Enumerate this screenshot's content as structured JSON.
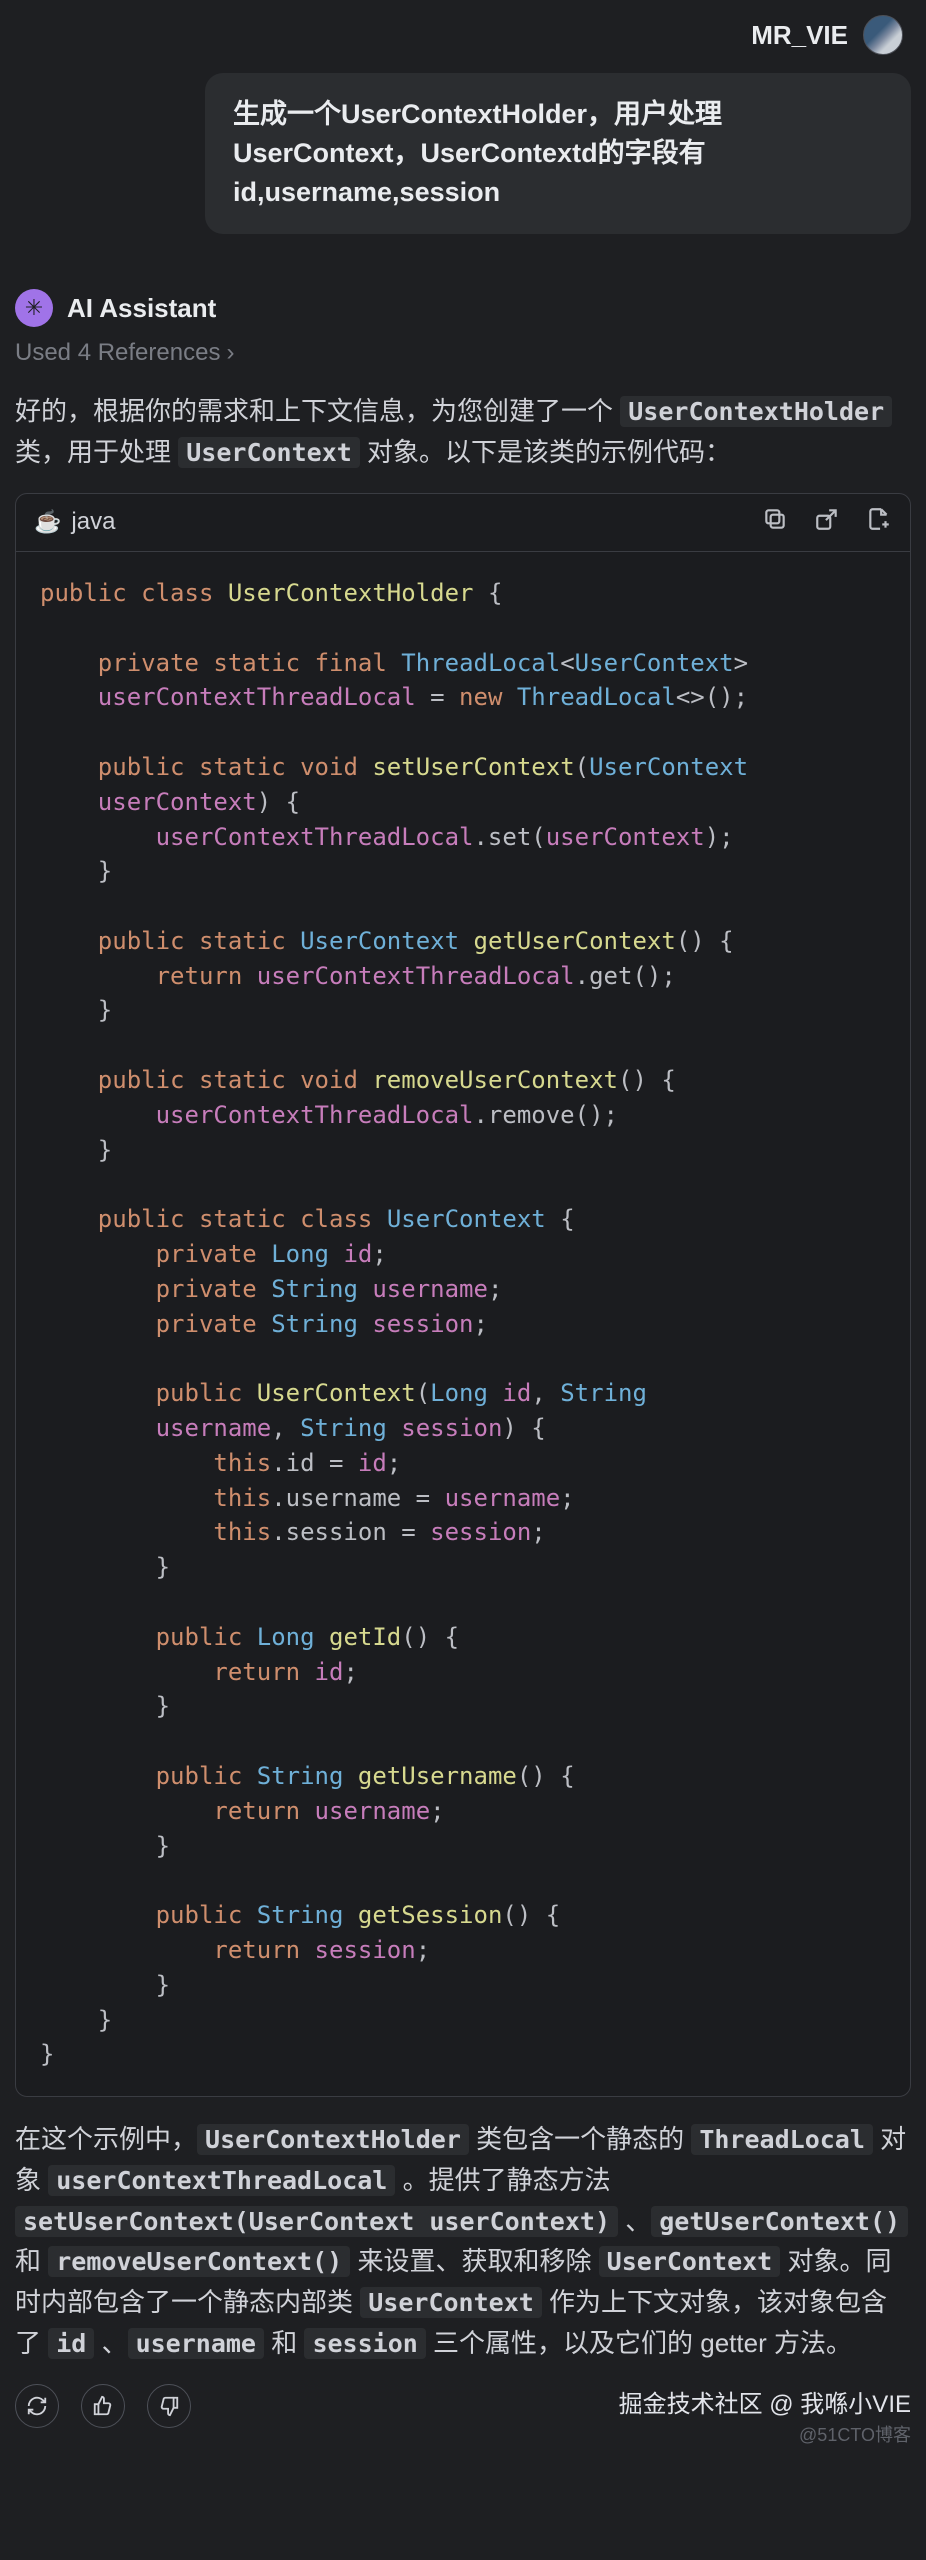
{
  "user": {
    "name": "MR_VIE"
  },
  "prompt": "生成一个UserContextHolder，用户处理UserContext，UserContextd的字段有id,username,session",
  "assistant_label": "AI Assistant",
  "references_label": "Used 4 References",
  "reply_intro_1": "好的，根据你的需求和上下文信息，为您创建了一个",
  "reply_intro_code1": "UserContextHolder",
  "reply_intro_2": " 类，用于处理 ",
  "reply_intro_code2": "UserContext",
  "reply_intro_3": " 对象。以下是该类的示例代码：",
  "code_lang": "java",
  "explain": {
    "l1a": "在这个示例中，",
    "c1": "UserContextHolder",
    "l1b": " 类包含一个静态的 ",
    "c2": "ThreadLocal",
    "l2a": " 对象 ",
    "c3": "userContextThreadLocal",
    "l2b": " 。提供了静态方法 ",
    "c4": "setUserContext(UserContext userContext)",
    "l3a": " 、",
    "c5": "getUserContext()",
    "l3b": " 和 ",
    "c6": "removeUserContext()",
    "l3c": " 来设置、获取和移除 ",
    "c7": "UserContext",
    "l4a": " 对象。同时内部包含了一个静态内部类 ",
    "c8": "UserContext",
    "l4b": " 作为上下文对象，该对象包含了 ",
    "c9": "id",
    "l5a": " 、",
    "c10": "username",
    "l5b": " 和 ",
    "c11": "session",
    "l5c": " 三个属性，以及它们的 getter 方法。"
  },
  "watermark": {
    "line1": "掘金技术社区 @ 我喺小VIE",
    "line2": "@51CTO博客"
  },
  "code": {
    "l01a": "public",
    "l01b": "class",
    "l01c": "UserContextHolder",
    "l01d": "{",
    "l02a": "private",
    "l02b": "static",
    "l02c": "final",
    "l02d": "ThreadLocal",
    "l02e": "UserContext",
    "l03a": "userContextThreadLocal",
    "l03b": "=",
    "l03c": "new",
    "l03d": "ThreadLocal",
    "l03e": "<>();",
    "l04a": "public",
    "l04b": "static",
    "l04c": "void",
    "l04d": "setUserContext",
    "l04e": "UserContext",
    "l04f": "userContext",
    "l04g": ") {",
    "l05a": "userContextThreadLocal",
    "l05b": ".set(",
    "l05c": "userContext",
    "l05d": ");",
    "l06a": "}",
    "l07a": "public",
    "l07b": "static",
    "l07c": "UserContext",
    "l07d": "getUserContext",
    "l07e": "() {",
    "l08a": "return",
    "l08b": "userContextThreadLocal",
    "l08c": ".get();",
    "l09a": "}",
    "l10a": "public",
    "l10b": "static",
    "l10c": "void",
    "l10d": "removeUserContext",
    "l10e": "() {",
    "l11a": "userContextThreadLocal",
    "l11b": ".remove();",
    "l12a": "}",
    "l13a": "public",
    "l13b": "static",
    "l13c": "class",
    "l13d": "UserContext",
    "l13e": "{",
    "l14a": "private",
    "l14b": "Long",
    "l14c": "id",
    "l14d": ";",
    "l15a": "private",
    "l15b": "String",
    "l15c": "username",
    "l15d": ";",
    "l16a": "private",
    "l16b": "String",
    "l16c": "session",
    "l16d": ";",
    "l17a": "public",
    "l17b": "UserContext",
    "l17c": "Long",
    "l17d": "id",
    "l17e": ",",
    "l17f": "String",
    "l18a": "username",
    "l18b": ",",
    "l18c": "String",
    "l18d": "session",
    "l18e": ") {",
    "l19a": "this",
    "l19b": ".id = ",
    "l19c": "id",
    "l19d": ";",
    "l20a": "this",
    "l20b": ".username = ",
    "l20c": "username",
    "l20d": ";",
    "l21a": "this",
    "l21b": ".session = ",
    "l21c": "session",
    "l21d": ";",
    "l22a": "}",
    "l23a": "public",
    "l23b": "Long",
    "l23c": "getId",
    "l23d": "() {",
    "l24a": "return",
    "l24b": "id",
    "l24c": ";",
    "l25a": "}",
    "l26a": "public",
    "l26b": "String",
    "l26c": "getUsername",
    "l26d": "() {",
    "l27a": "return",
    "l27b": "username",
    "l27c": ";",
    "l28a": "}",
    "l29a": "public",
    "l29b": "String",
    "l29c": "getSession",
    "l29d": "() {",
    "l30a": "return",
    "l30b": "session",
    "l30c": ";",
    "l31a": "}",
    "l32a": "}",
    "l33a": "}"
  }
}
